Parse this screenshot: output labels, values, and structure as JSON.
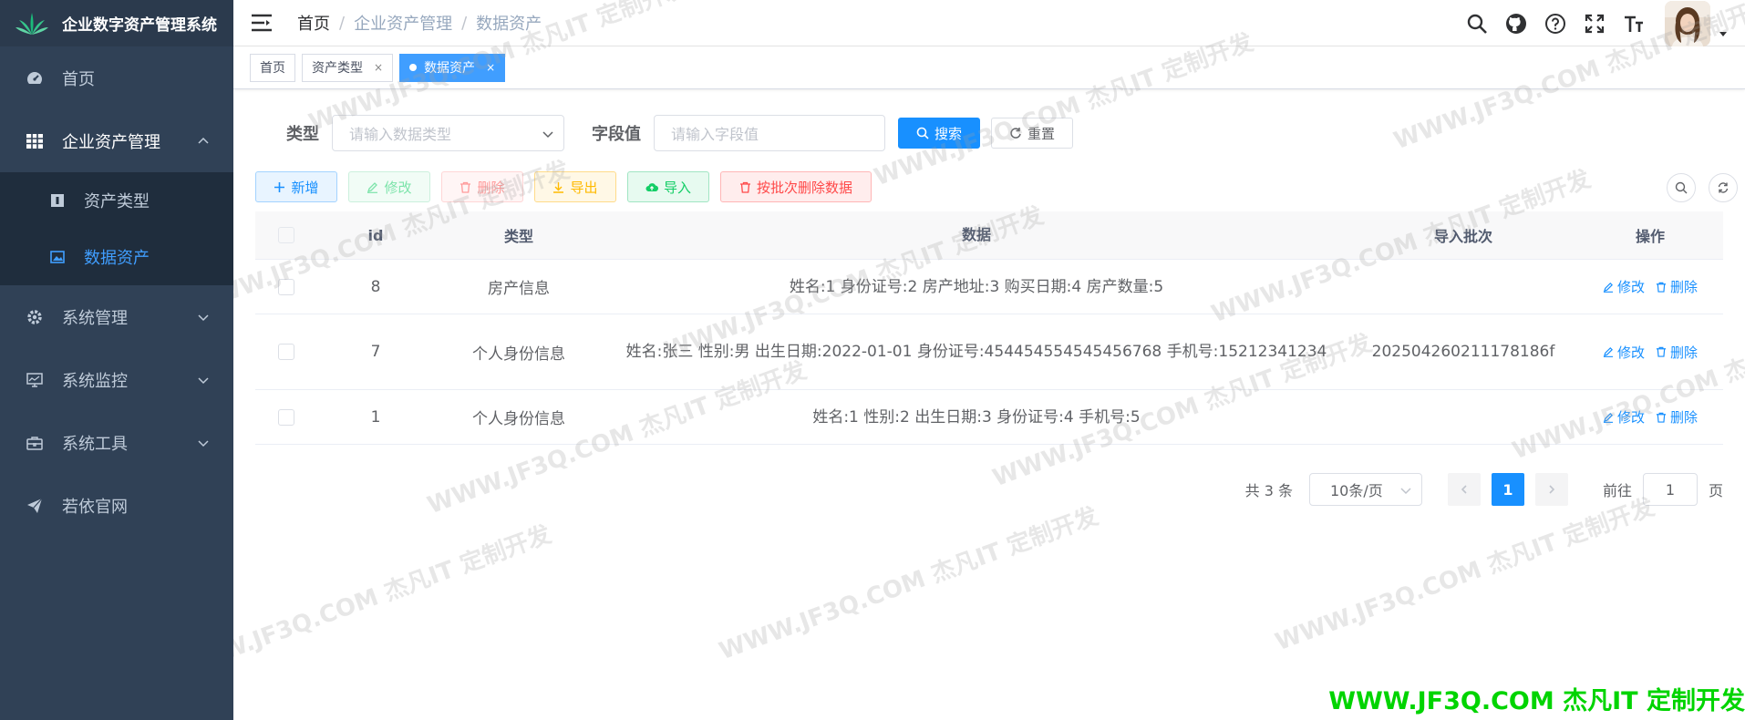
{
  "app": {
    "title": "企业数字资产管理系统"
  },
  "sidebar": {
    "items": [
      {
        "label": "首页",
        "icon": "dashboard-icon"
      },
      {
        "label": "企业资产管理",
        "icon": "grid-icon"
      },
      {
        "label": "系统管理",
        "icon": "gear-icon"
      },
      {
        "label": "系统监控",
        "icon": "monitor-icon"
      },
      {
        "label": "系统工具",
        "icon": "toolbox-icon"
      },
      {
        "label": "若依官网",
        "icon": "send-icon"
      }
    ],
    "subitems": [
      {
        "label": "资产类型",
        "icon": "type-icon"
      },
      {
        "label": "数据资产",
        "icon": "image-icon"
      }
    ]
  },
  "header": {
    "breadcrumb": [
      "首页",
      "企业资产管理",
      "数据资产"
    ],
    "separator": "/"
  },
  "tags": [
    {
      "label": "首页"
    },
    {
      "label": "资产类型",
      "close": "×"
    },
    {
      "label": "数据资产",
      "close": "×"
    }
  ],
  "search": {
    "type_label": "类型",
    "type_placeholder": "请输入数据类型",
    "field_label": "字段值",
    "field_placeholder": "请输入字段值",
    "search_btn": "搜索",
    "reset_btn": "重置"
  },
  "toolbar": {
    "add": "新增",
    "edit": "修改",
    "delete": "删除",
    "export": "导出",
    "import": "导入",
    "batch_delete": "按批次删除数据"
  },
  "table": {
    "headers": [
      "id",
      "类型",
      "数据",
      "导入批次",
      "操作"
    ],
    "rows": [
      {
        "id": "8",
        "type": "房产信息",
        "data": "姓名:1   身份证号:2   房产地址:3   购买日期:4   房产数量:5",
        "batch": ""
      },
      {
        "id": "7",
        "type": "个人身份信息",
        "data": "姓名:张三   性别:男   出生日期:2022-01-01   身份证号:454454554545456768   手机号:15212341234",
        "batch": "20250426021117818​6f"
      },
      {
        "id": "1",
        "type": "个人身份信息",
        "data": "姓名:1   性别:2   出生日期:3   身份证号:4   手机号:5",
        "batch": ""
      }
    ],
    "op_edit": "修改",
    "op_delete": "删除"
  },
  "pager": {
    "total": "共 3 条",
    "page_size": "10条/页",
    "current": "1",
    "goto_prefix": "前往",
    "goto_value": "1",
    "goto_suffix": "页"
  },
  "watermark": {
    "text": "WWW.JF3Q.COM 杰凡IT  定制开发",
    "corner": "WWW.JF3Q.COM 杰凡IT  定制开发",
    "corner_color": "#00d400"
  },
  "colors": {
    "sidebar": "#304156",
    "primary": "#1890ff",
    "active_tag": "#409eff"
  }
}
